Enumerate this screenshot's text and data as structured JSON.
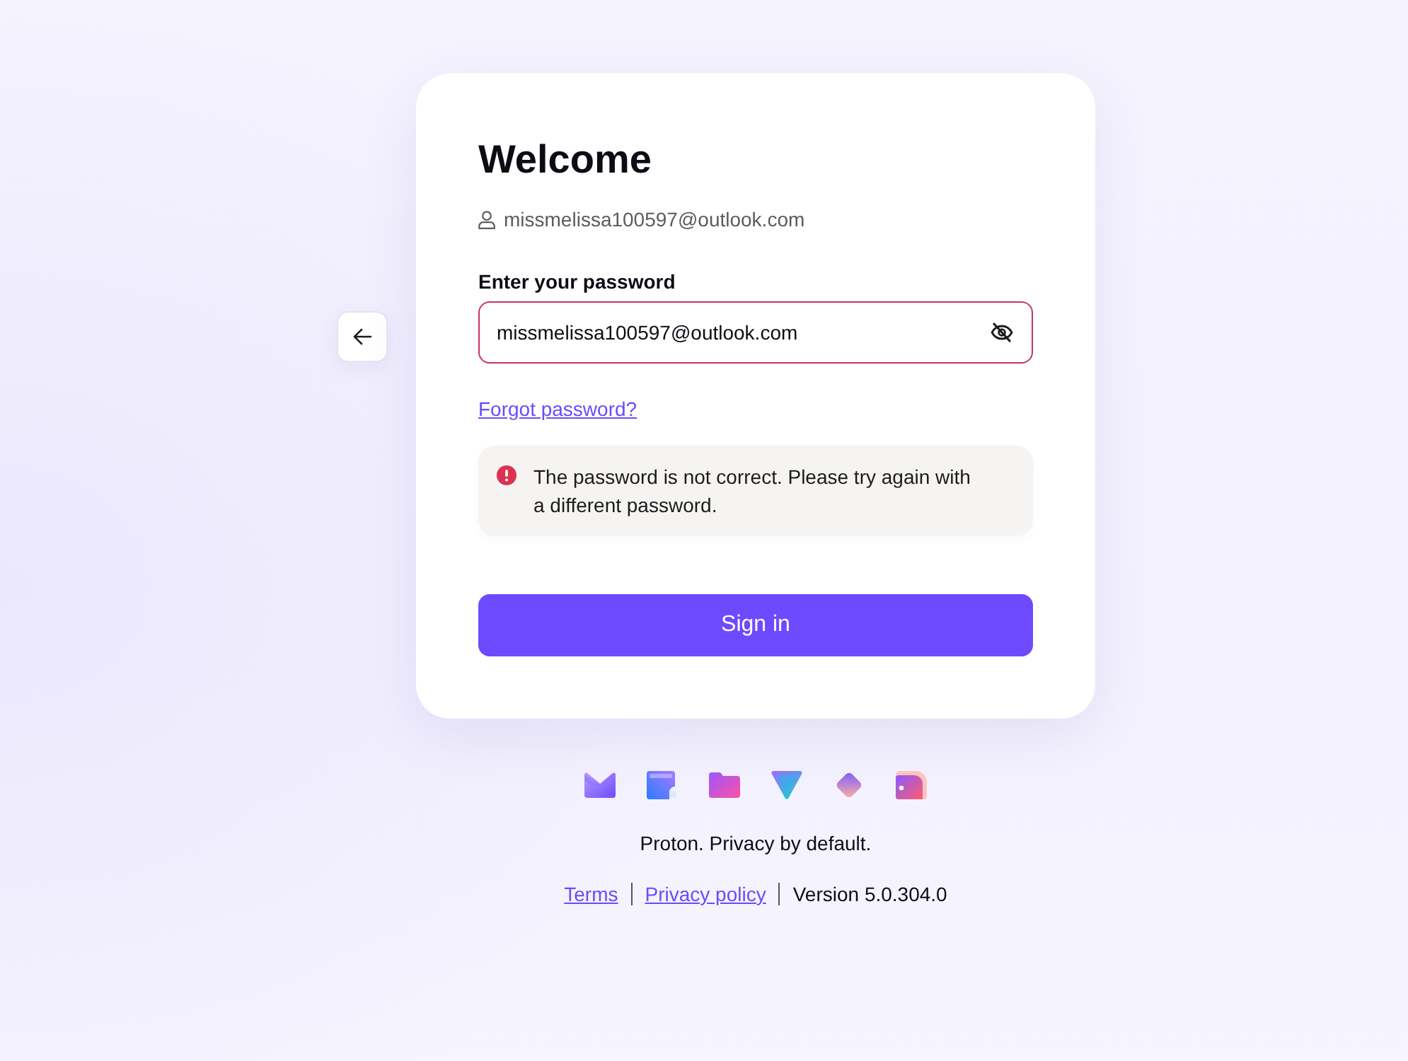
{
  "card": {
    "title": "Welcome",
    "account": "missmelissa100597@outlook.com",
    "password_field": {
      "label": "Enter your password",
      "value": "missmelissa100597@outlook.com",
      "error": true,
      "password_visible": true
    },
    "forgot_link": "Forgot password?",
    "error_message": "The password is not correct. Please try again with a different password.",
    "submit_button": "Sign in"
  },
  "footer": {
    "tagline": "Proton. Privacy by default.",
    "links": [
      {
        "label": "Terms"
      },
      {
        "label": "Privacy policy"
      }
    ],
    "version": "Version 5.0.304.0"
  }
}
